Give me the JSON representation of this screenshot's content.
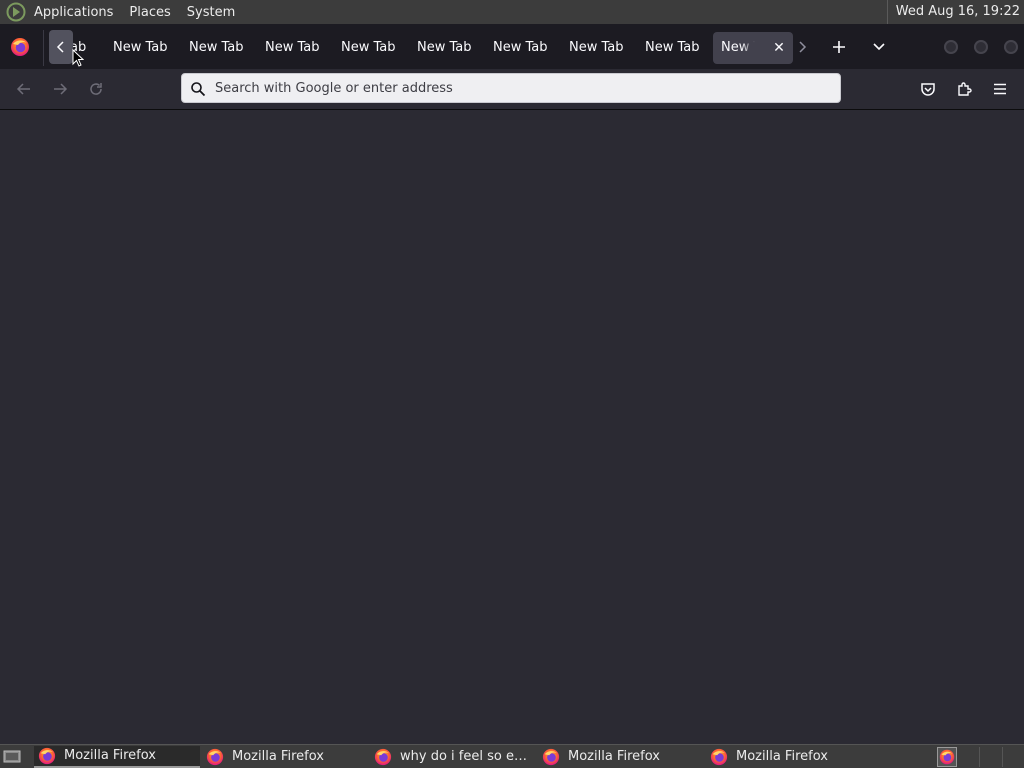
{
  "top_panel": {
    "menus": [
      "Applications",
      "Places",
      "System"
    ],
    "clock": "Wed Aug 16, 19:22"
  },
  "tabs": {
    "partial_first_label": "ab",
    "items": [
      "New Tab",
      "New Tab",
      "New Tab",
      "New Tab",
      "New Tab",
      "New Tab",
      "New Tab",
      "New Tab"
    ],
    "active_label": "New Tab",
    "active_close": "✕"
  },
  "navbar": {
    "url_placeholder": "Search with Google or enter address",
    "url_value": ""
  },
  "taskbar": {
    "tasks": [
      {
        "label": "Mozilla Firefox",
        "active": true
      },
      {
        "label": "Mozilla Firefox",
        "active": false
      },
      {
        "label": "why do i feel so em…",
        "active": false
      },
      {
        "label": "Mozilla Firefox",
        "active": false
      },
      {
        "label": "Mozilla Firefox",
        "active": false
      }
    ]
  },
  "colors": {
    "panel_bg": "#3c3c3c",
    "tabbar_bg": "#1c1b22",
    "toolbar_bg": "#2b2a33",
    "content_bg": "#2b2a33",
    "text_light": "#fbfbfe",
    "active_tab_bg": "#42414d"
  },
  "icons": {
    "panel_logo": "mate-logo-icon",
    "browser": "firefox-icon",
    "back": "arrow-left-icon",
    "forward": "arrow-right-icon",
    "reload": "reload-icon",
    "search": "search-icon",
    "pocket": "pocket-icon",
    "extensions": "puzzle-icon",
    "menu": "hamburger-icon"
  }
}
